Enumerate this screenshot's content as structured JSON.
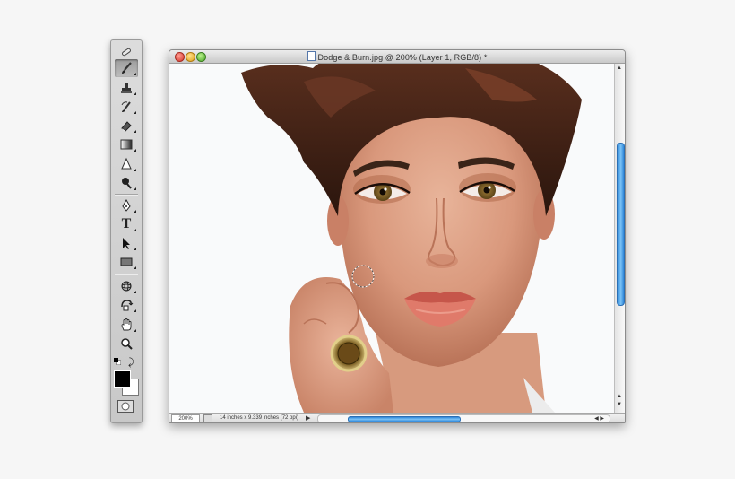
{
  "document": {
    "title": "Dodge & Burn.jpg @ 200% (Layer 1, RGB/8) *",
    "zoom": "200%",
    "info": "14 inches x 9.339 inches (72 ppi)"
  },
  "toolbar": {
    "tools": [
      {
        "name": "spot-healing-brush",
        "icon": "bandage-icon"
      },
      {
        "name": "brush",
        "icon": "brush-icon",
        "active": true
      },
      {
        "name": "clone-stamp",
        "icon": "stamp-icon"
      },
      {
        "name": "history-brush",
        "icon": "history-brush-icon"
      },
      {
        "name": "eraser",
        "icon": "eraser-icon"
      },
      {
        "name": "gradient",
        "icon": "gradient-icon"
      },
      {
        "name": "blur",
        "icon": "blur-icon"
      },
      {
        "name": "dodge",
        "icon": "dodge-icon"
      },
      {
        "name": "pen",
        "icon": "pen-icon"
      },
      {
        "name": "type",
        "icon": "type-icon",
        "label": "T"
      },
      {
        "name": "path-selection",
        "icon": "arrow-icon"
      },
      {
        "name": "rectangle",
        "icon": "rectangle-icon"
      },
      {
        "name": "3d-rotate",
        "icon": "3d-rotate-icon"
      },
      {
        "name": "3d-orbit",
        "icon": "3d-orbit-icon"
      },
      {
        "name": "hand",
        "icon": "hand-icon"
      },
      {
        "name": "zoom",
        "icon": "magnifier-icon"
      }
    ],
    "foreground_color": "#000000",
    "background_color": "#ffffff"
  },
  "colors": {
    "scroll_accent": "#3b92e0",
    "canvas_background": "#f9fafb"
  }
}
